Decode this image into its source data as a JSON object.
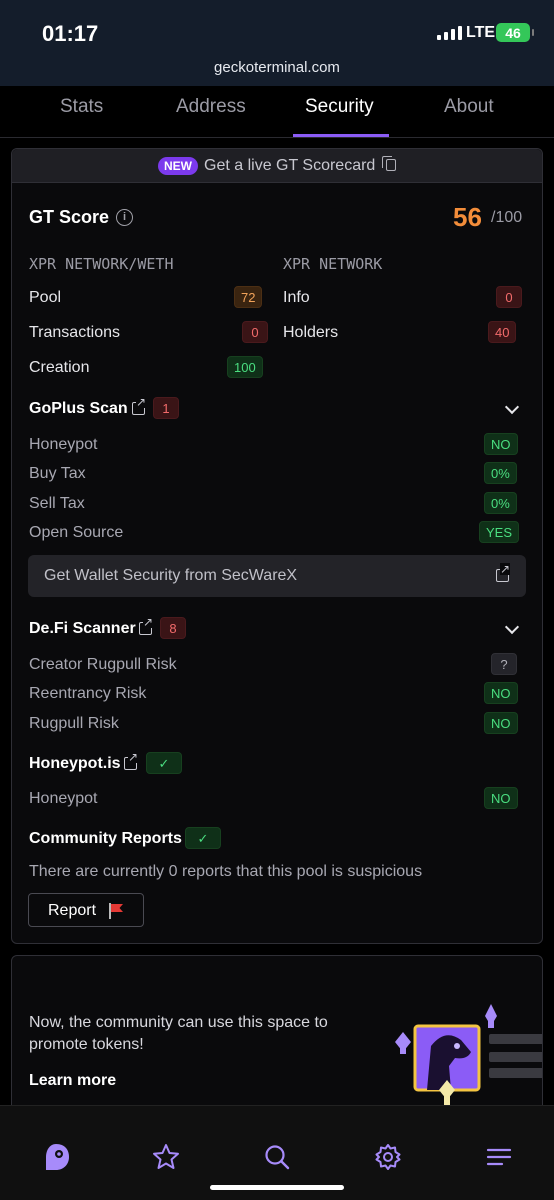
{
  "status_bar": {
    "time": "01:17",
    "network": "LTE",
    "battery": "46",
    "url": "geckoterminal.com"
  },
  "tabs": [
    {
      "label": "Stats",
      "active": false
    },
    {
      "label": "Address",
      "active": false
    },
    {
      "label": "Security",
      "active": true
    },
    {
      "label": "About",
      "active": false
    }
  ],
  "banner": {
    "badge": "NEW",
    "text": "Get a live GT Scorecard"
  },
  "gt_score": {
    "title": "GT Score",
    "score": "56",
    "max": "/100",
    "left_header": "XPR NETWORK/WETH",
    "right_header": "XPR NETWORK",
    "left_rows": [
      {
        "label": "Pool",
        "value": "72",
        "tone": "orange"
      },
      {
        "label": "Transactions",
        "value": "0",
        "tone": "red"
      },
      {
        "label": "Creation",
        "value": "100",
        "tone": "green"
      }
    ],
    "right_rows": [
      {
        "label": "Info",
        "value": "0",
        "tone": "red"
      },
      {
        "label": "Holders",
        "value": "40",
        "tone": "red"
      }
    ]
  },
  "goplus": {
    "title": "GoPlus Scan",
    "count": "1",
    "rows": [
      {
        "label": "Honeypot",
        "value": "NO"
      },
      {
        "label": "Buy Tax",
        "value": "0%"
      },
      {
        "label": "Sell Tax",
        "value": "0%"
      },
      {
        "label": "Open Source",
        "value": "YES"
      }
    ],
    "wallet_button": "Get Wallet Security from SecWareX"
  },
  "defi": {
    "title": "De.Fi Scanner",
    "count": "8",
    "rows": [
      {
        "label": "Creator Rugpull Risk",
        "value": "?"
      },
      {
        "label": "Reentrancy Risk",
        "value": "NO"
      },
      {
        "label": "Rugpull Risk",
        "value": "NO"
      }
    ]
  },
  "honeypot_is": {
    "title": "Honeypot.is",
    "check": "✓",
    "rows": [
      {
        "label": "Honeypot",
        "value": "NO"
      }
    ]
  },
  "community": {
    "title": "Community Reports",
    "check": "✓",
    "text": "There are currently 0 reports that this pool is suspicious",
    "report_label": "Report"
  },
  "promo": {
    "text": "Now, the community can use this space to promote tokens!",
    "link": "Learn more"
  },
  "bottom_nav": [
    {
      "icon": "gecko-logo-icon"
    },
    {
      "icon": "star-icon"
    },
    {
      "icon": "search-icon"
    },
    {
      "icon": "gear-icon"
    },
    {
      "icon": "menu-icon"
    }
  ],
  "colors": {
    "accent": "#8b5cf6",
    "score": "#f38d3a",
    "background": "#000000"
  }
}
